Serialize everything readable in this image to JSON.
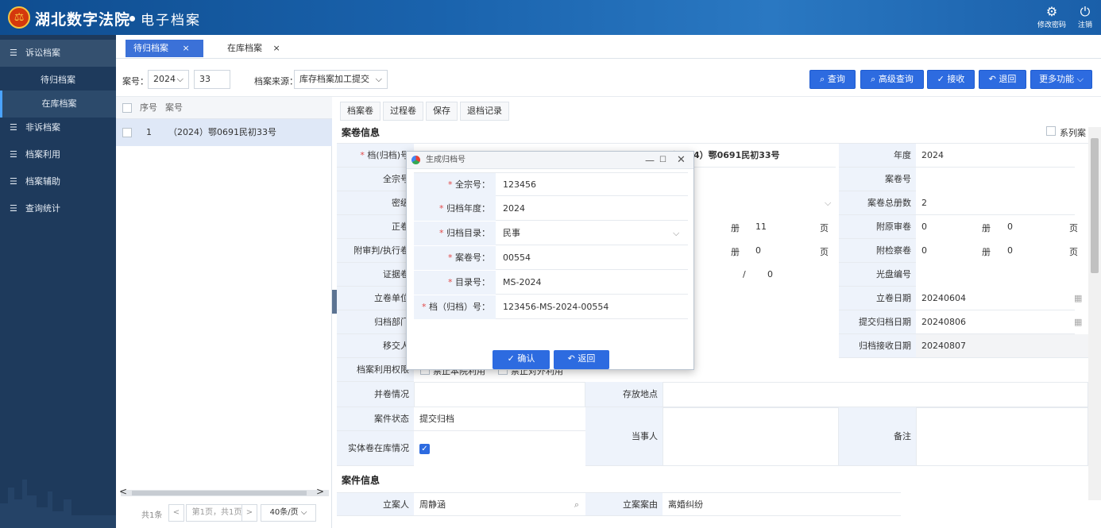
{
  "header": {
    "title": "湖北数字法院",
    "subtitle": "电子档案",
    "logo_glyph": "⚖",
    "change_password": "修改密码",
    "logout": "注销"
  },
  "sidebar": {
    "items": [
      {
        "label": "诉讼档案"
      },
      {
        "label": "待归档案"
      },
      {
        "label": "在库档案"
      },
      {
        "label": "非诉档案"
      },
      {
        "label": "档案利用"
      },
      {
        "label": "档案辅助"
      },
      {
        "label": "查询统计"
      }
    ],
    "menu_glyph": "☰"
  },
  "tabs": [
    {
      "label": "待归档案",
      "close": "×"
    },
    {
      "label": "在库档案",
      "close": "×"
    }
  ],
  "filter": {
    "case_label": "案号：",
    "year": "2024",
    "case_prefix": "33",
    "source_label": "档案来源：",
    "source_value": "库存档案加工提交",
    "buttons": {
      "query": "查询",
      "advanced": "高级查询",
      "receive": "接收",
      "return": "退回",
      "more": "更多功能"
    }
  },
  "list": {
    "col_seq": "序号",
    "col_case": "案号",
    "rows": [
      {
        "seq": "1",
        "case": "（2024）鄂0691民初33号"
      }
    ],
    "footer": {
      "total": "共1条",
      "page_info": "第1页，共1页",
      "page_size": "40条/页",
      "prev": "<",
      "next": ">"
    }
  },
  "subtabs": [
    "档案卷",
    "过程卷",
    "保存",
    "退档记录"
  ],
  "detail": {
    "section_title": "案卷信息",
    "series_label": "系列案",
    "rows": {
      "archive_no_label": "档(归档)号",
      "case_no_value": "（2024）鄂0691民初33号",
      "year_label": "年度",
      "year_value": "2024",
      "fonds_label": "全宗号",
      "volume_no_label": "案卷号",
      "secret_label": "密级",
      "total_vol_label": "案卷总册数",
      "total_vol_value": "2",
      "main_label": "正卷",
      "main_vol": "11",
      "unit_ce": "册",
      "unit_ye": "页",
      "orig_review_label": "附原审卷",
      "orig_review_vol": "0",
      "orig_review_page": "0",
      "appendix_label": "附审判/执行卷",
      "appendix_vol": "0",
      "procuratorate_label": "附检察卷",
      "procuratorate_vol": "0",
      "procuratorate_page": "0",
      "evidence_label": "证据卷",
      "evidence_sep": "/",
      "evidence_value": "0",
      "disc_label": "光盘编号",
      "filing_unit_label": "立卷单位",
      "filing_date_label": "立卷日期",
      "filing_date_value": "20240604",
      "archive_dept_label": "归档部门",
      "submit_date_label": "提交归档日期",
      "submit_date_value": "20240806",
      "transfer_label": "移交人",
      "receive_date_label": "归档接收日期",
      "receive_date_value": "20240807",
      "usage_label": "档案利用权限",
      "usage_opt1": "禁止本院利用",
      "usage_opt2": "禁止对外利用",
      "merge_label": "并卷情况",
      "storage_label": "存放地点",
      "status_label": "案件状态",
      "status_value": "提交归档",
      "party_label": "当事人",
      "remark_label": "备注",
      "physical_label": "实体卷在库情况"
    },
    "section2_title": "案件信息",
    "judge_label": "立案人",
    "judge_value": "周静涵",
    "cause_label": "立案案由",
    "cause_value": "离婚纠纷"
  },
  "dialog": {
    "title": "生成归档号",
    "fields": [
      {
        "label": "全宗号：",
        "value": "123456"
      },
      {
        "label": "归档年度：",
        "value": "2024"
      },
      {
        "label": "归档目录：",
        "value": "民事"
      },
      {
        "label": "案卷号：",
        "value": "00554"
      },
      {
        "label": "目录号：",
        "value": "MS-2024"
      },
      {
        "label": "档（归档）号：",
        "value": "123456-MS-2024-00554"
      }
    ],
    "confirm": "确认",
    "back": "返回",
    "req_mark": "*"
  }
}
